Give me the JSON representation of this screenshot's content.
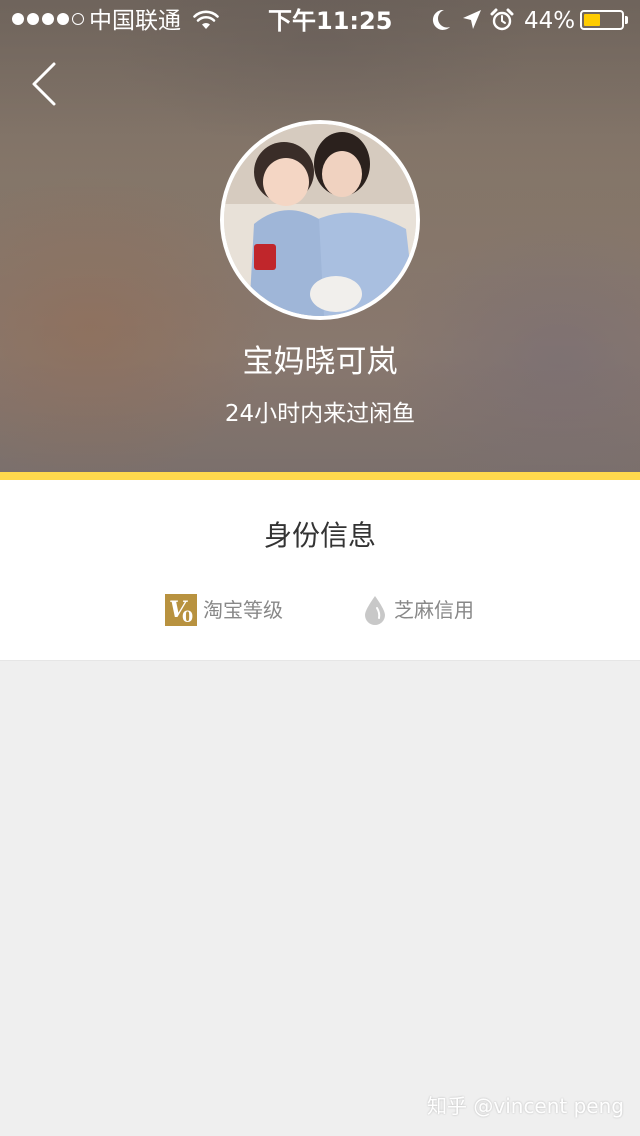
{
  "status_bar": {
    "carrier": "中国联通",
    "time": "下午11:25",
    "battery_percent_label": "44%",
    "battery_level": 0.44,
    "signal_bars": 4,
    "signal_max": 5,
    "icons": [
      "wifi-icon",
      "moon-icon",
      "location-arrow-icon",
      "alarm-icon",
      "battery-icon"
    ],
    "battery_color": "#ffcc00"
  },
  "header": {
    "back_icon": "chevron-left-icon",
    "user_name": "宝妈晓可岚",
    "activity": "24小时内来过闲鱼",
    "accent_color": "#ffd94d"
  },
  "identity": {
    "title": "身份信息",
    "badges": [
      {
        "icon": "v0-level-icon",
        "label": "淘宝等级"
      },
      {
        "icon": "sesame-drop-icon",
        "label": "芝麻信用"
      }
    ]
  },
  "watermark": "知乎 @vincent peng"
}
